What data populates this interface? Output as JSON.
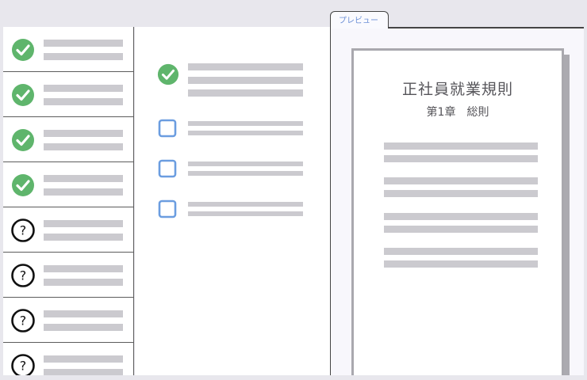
{
  "colors": {
    "check_green": "#5fb56c",
    "checkbox_blue": "#6b9de0",
    "placeholder_gray": "#cbcacf",
    "tab_text_blue": "#6b8fd6"
  },
  "sidebar": {
    "items": [
      {
        "status": "complete",
        "icon": "check-circle-icon"
      },
      {
        "status": "complete",
        "icon": "check-circle-icon"
      },
      {
        "status": "complete",
        "icon": "check-circle-icon"
      },
      {
        "status": "complete",
        "icon": "check-circle-icon"
      },
      {
        "status": "unknown",
        "icon": "question-circle-icon"
      },
      {
        "status": "unknown",
        "icon": "question-circle-icon"
      },
      {
        "status": "unknown",
        "icon": "question-circle-icon"
      },
      {
        "status": "unknown",
        "icon": "question-circle-icon"
      }
    ]
  },
  "checklist": {
    "items": [
      {
        "state": "checked",
        "icon": "check-circle-icon"
      },
      {
        "state": "unchecked",
        "icon": "checkbox-icon"
      },
      {
        "state": "unchecked",
        "icon": "checkbox-icon"
      },
      {
        "state": "unchecked",
        "icon": "checkbox-icon"
      }
    ]
  },
  "preview": {
    "tab_label": "プレビュー",
    "document": {
      "title": "正社員就業規則",
      "chapter": "第1章　総則"
    }
  }
}
